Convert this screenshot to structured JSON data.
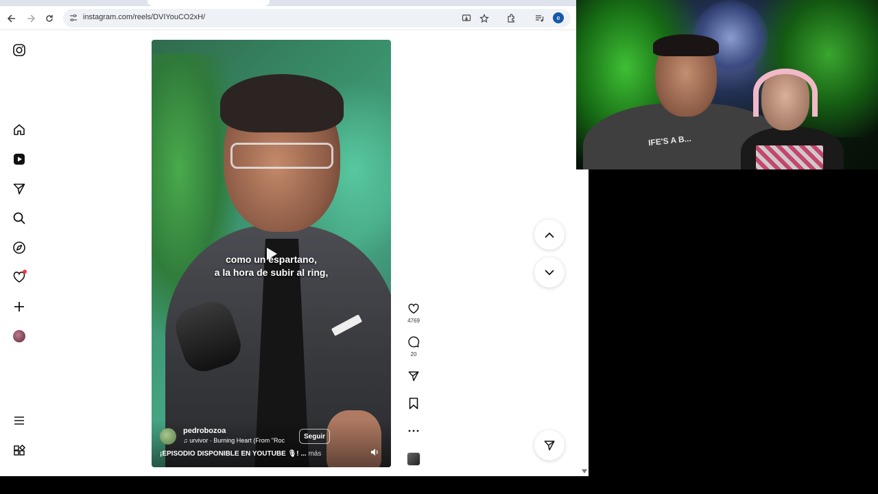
{
  "browser": {
    "url": "instagram.com/reels/DVIYouCO2xH/",
    "profile_initial": "e",
    "accent_color": "#1558a8"
  },
  "sidebar": {
    "items": [
      {
        "name": "instagram-logo-icon"
      },
      {
        "name": "home-icon"
      },
      {
        "name": "reels-icon"
      },
      {
        "name": "messages-icon"
      },
      {
        "name": "search-icon"
      },
      {
        "name": "explore-icon"
      },
      {
        "name": "notifications-icon"
      },
      {
        "name": "create-icon"
      },
      {
        "name": "profile-avatar"
      },
      {
        "name": "more-menu-icon"
      },
      {
        "name": "also-from-meta-icon"
      }
    ]
  },
  "reel": {
    "caption_line1": "como un espartano,",
    "caption_line2": "a la hora de subir al ring,",
    "username": "pedrobozoa",
    "music": "urvivor · Burning Heart (From \"Roc",
    "follow_label": "Seguir",
    "description": "¡EPISODIO DISPONIBLE EN YOUTUBE 🎙! ...",
    "more_label": "más"
  },
  "actions": {
    "likes": "4769",
    "comments": "20"
  },
  "webcam": {
    "shirt_text": "IFE'S A B..."
  }
}
